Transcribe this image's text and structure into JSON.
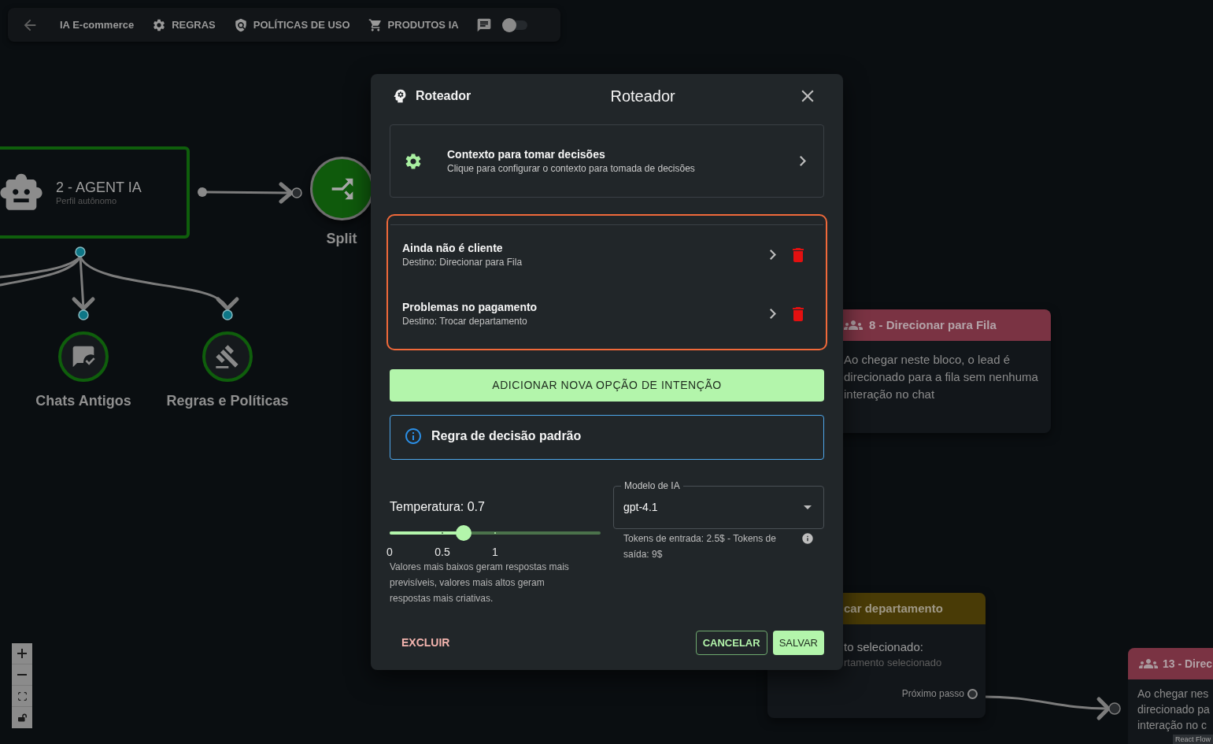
{
  "toolbar": {
    "title": "IA E-commerce",
    "items": [
      {
        "label": "REGRAS"
      },
      {
        "label": "POLÍTICAS DE USO"
      },
      {
        "label": "PRODUTOS IA"
      }
    ],
    "toggle": {
      "on": false
    }
  },
  "canvas": {
    "agent_node": {
      "title": "2 - AGENT IA",
      "subtitle": "Perfil autônomo"
    },
    "split_node": {
      "label": "Split"
    },
    "tool_nodes": [
      {
        "label": "Chats Antigos"
      },
      {
        "label": "Regras e Políticas"
      }
    ],
    "queue_card": {
      "title": "8 - Direcionar para Fila",
      "description": [
        "Ao chegar neste bloco, o lead é",
        "direcionado para a fila sem nenhuma",
        "interação no chat"
      ]
    },
    "department_card": {
      "title": "car departamento",
      "line_1": "to selecionado:",
      "line_2": "rtamento selecionado",
      "output_label": "Próximo passo"
    },
    "queue_card_2": {
      "title": "13 - Direc",
      "description": [
        "Ao chegar nes",
        "direcionado pa",
        "interação no c"
      ]
    },
    "attribution": "React Flow"
  },
  "dialog": {
    "label": "Roteador",
    "title": "Roteador",
    "context": {
      "title": "Contexto para tomar decisões",
      "subtitle": "Clique para configurar o contexto para tomada de decisões"
    },
    "intents": [
      {
        "title": "Ainda não é cliente",
        "destination": "Destino: Direcionar para Fila"
      },
      {
        "title": "Problemas no pagamento",
        "destination": "Destino: Trocar departamento"
      }
    ],
    "add_button": "ADICIONAR NOVA OPÇÃO DE INTENÇÃO",
    "default_rule": "Regra de decisão padrão",
    "temperature": {
      "label": "Temperatura: 0.7",
      "level": 0.35,
      "marks": [
        "0",
        "0.5",
        "1"
      ],
      "help": "Valores mais baixos geram respostas mais previsíveis, valores mais altos geram respostas mais criativas."
    },
    "model": {
      "label": "Modelo de IA",
      "value": "gpt-4.1",
      "note": "Tokens de entrada: 2.5$ - Tokens de saída: 9$"
    },
    "buttons": {
      "delete": "EXCLUIR",
      "cancel": "CANCELAR",
      "save": "SALVAR"
    }
  }
}
